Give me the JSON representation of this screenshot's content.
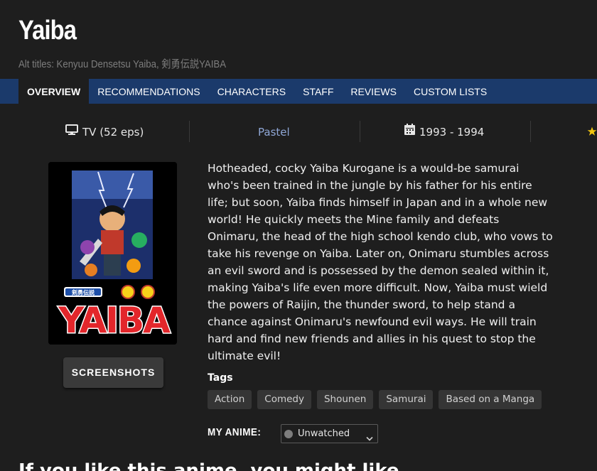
{
  "header": {
    "title": "Yaiba",
    "alt_titles": "Alt titles: Kenyuu Densetsu Yaiba, 剣勇伝説YAIBA"
  },
  "nav": {
    "tabs": [
      {
        "label": "OVERVIEW",
        "active": true
      },
      {
        "label": "RECOMMENDATIONS"
      },
      {
        "label": "CHARACTERS"
      },
      {
        "label": "STAFF"
      },
      {
        "label": "REVIEWS"
      },
      {
        "label": "CUSTOM LISTS"
      }
    ]
  },
  "info": {
    "format": "TV (52 eps)",
    "format_icon": "tv-icon",
    "studio": "Pastel",
    "years": "1993 - 1994",
    "years_icon": "calendar-icon",
    "rating_icon": "star-icon"
  },
  "poster": {
    "logo_text": "YAIBA",
    "banner_text": "剣勇伝説"
  },
  "screenshots_label": "SCREENSHOTS",
  "synopsis": "Hotheaded, cocky Yaiba Kurogane is a would-be samurai who's been trained in the jungle by his father for his entire life; but soon, Yaiba finds himself in Japan and in a whole new world! He quickly meets the Mine family and defeats Onimaru, the head of the high school kendo club, who vows to take his revenge on Yaiba. Later on, Onimaru stumbles across an evil sword and is possessed by the demon sealed within it, making Yaiba's life even more difficult. Now, Yaiba must wield the powers of Raijin, the thunder sword, to help stand a chance against Onimaru's newfound evil ways. He will train hard and find new friends and allies in his quest to stop the ultimate evil!",
  "tags": {
    "heading": "Tags",
    "items": [
      "Action",
      "Comedy",
      "Shounen",
      "Samurai",
      "Based on a Manga"
    ]
  },
  "my_anime": {
    "label": "MY ANIME:",
    "status": "Unwatched",
    "status_color": "#7d7d7d"
  },
  "bottom_heading": "If you like this anime, you might like..."
}
